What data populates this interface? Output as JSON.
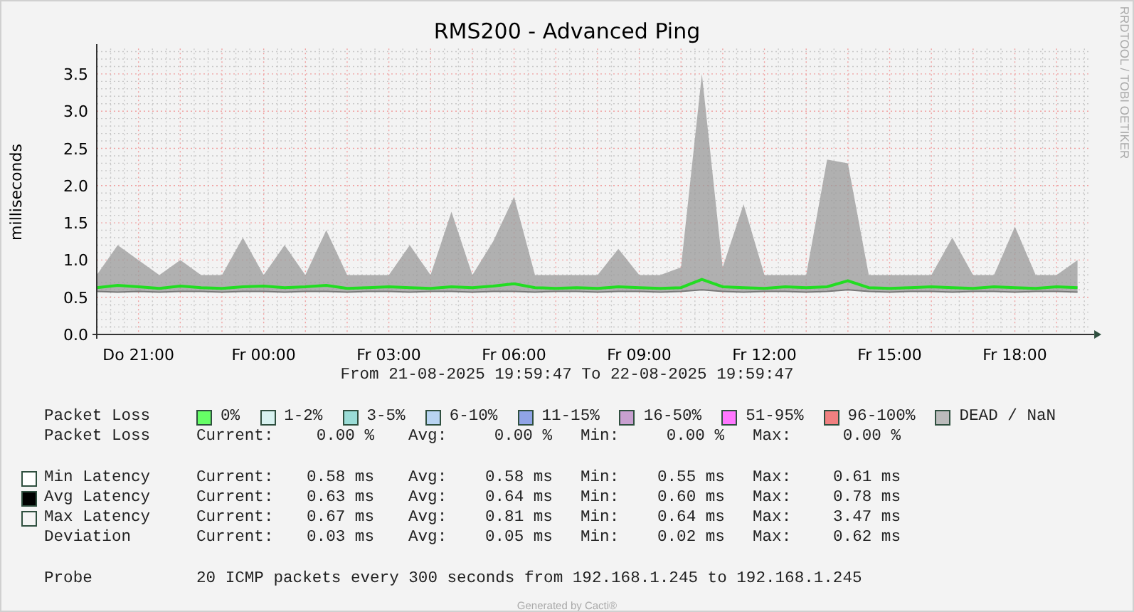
{
  "title": "RMS200 - Advanced Ping",
  "side_label": "RRDTOOL / TOBI OETIKER",
  "chart_data": {
    "type": "line",
    "grid": true,
    "ylabel": "milliseconds",
    "ylim": [
      0,
      3.84
    ],
    "categories": [
      null,
      null,
      "Do 21:00",
      null,
      null,
      null,
      null,
      null,
      "Fr 00:00",
      null,
      null,
      null,
      null,
      null,
      "Fr 03:00",
      null,
      null,
      null,
      null,
      null,
      "Fr 06:00",
      null,
      null,
      null,
      null,
      null,
      "Fr 09:00",
      null,
      null,
      null,
      null,
      null,
      "Fr 12:00",
      null,
      null,
      null,
      null,
      null,
      "Fr 15:00",
      null,
      null,
      null,
      null,
      null,
      "Fr 18:00",
      null,
      null,
      null
    ],
    "yticks": [
      {
        "value": 0,
        "label": "0.0"
      },
      {
        "value": 0.5,
        "label": "0.5"
      },
      {
        "value": 1,
        "label": "1.0"
      },
      {
        "value": 1.5,
        "label": "1.5"
      },
      {
        "value": 2,
        "label": "2.0"
      },
      {
        "value": 2.5,
        "label": "2.5"
      },
      {
        "value": 3,
        "label": "3.0"
      },
      {
        "value": 3.5,
        "label": "3.5"
      }
    ],
    "series": [
      {
        "color": "#777777",
        "values": [
          0.58,
          0.57,
          0.58,
          0.57,
          0.58,
          0.58,
          0.57,
          0.58,
          0.58,
          0.57,
          0.58,
          0.58,
          0.57,
          0.58,
          0.58,
          0.57,
          0.58,
          0.58,
          0.57,
          0.58,
          0.58,
          0.57,
          0.58,
          0.58,
          0.57,
          0.58,
          0.58,
          0.57,
          0.58,
          0.6,
          0.58,
          0.57,
          0.58,
          0.58,
          0.57,
          0.58,
          0.6,
          0.58,
          0.57,
          0.58,
          0.58,
          0.57,
          0.58,
          0.58,
          0.57,
          0.58,
          0.58,
          0.57
        ]
      },
      {
        "color": "#22dd22",
        "values": [
          0.63,
          0.66,
          0.64,
          0.62,
          0.65,
          0.63,
          0.62,
          0.64,
          0.65,
          0.63,
          0.64,
          0.66,
          0.62,
          0.63,
          0.64,
          0.63,
          0.62,
          0.64,
          0.63,
          0.65,
          0.68,
          0.63,
          0.62,
          0.63,
          0.62,
          0.64,
          0.63,
          0.62,
          0.63,
          0.74,
          0.64,
          0.63,
          0.62,
          0.64,
          0.63,
          0.64,
          0.72,
          0.63,
          0.62,
          0.63,
          0.64,
          0.63,
          0.62,
          0.64,
          0.63,
          0.62,
          0.64,
          0.63
        ]
      },
      {
        "type": "area",
        "color": "#999999",
        "values": [
          0.8,
          1.2,
          1.0,
          0.8,
          1.0,
          0.8,
          0.8,
          1.3,
          0.8,
          1.2,
          0.8,
          1.4,
          0.8,
          0.8,
          0.8,
          1.2,
          0.8,
          1.65,
          0.8,
          1.25,
          1.85,
          0.8,
          0.8,
          0.8,
          0.8,
          1.15,
          0.8,
          0.8,
          0.9,
          3.5,
          0.9,
          1.75,
          0.8,
          0.8,
          0.8,
          2.35,
          2.3,
          0.8,
          0.8,
          0.8,
          0.8,
          1.3,
          0.8,
          0.8,
          1.45,
          0.8,
          0.8,
          1.0
        ]
      }
    ]
  },
  "period": "From 21-08-2025 19:59:47 To 22-08-2025 19:59:47",
  "loss_legend": {
    "label": "Packet Loss",
    "items": [
      {
        "label": "0%",
        "color": "#66ff66"
      },
      {
        "label": "1-2%",
        "color": "#d8f2f0"
      },
      {
        "label": "3-5%",
        "color": "#9adcd6"
      },
      {
        "label": "6-10%",
        "color": "#b8d4f2"
      },
      {
        "label": "11-15%",
        "color": "#90a4e6"
      },
      {
        "label": "16-50%",
        "color": "#c8a0d0"
      },
      {
        "label": "51-95%",
        "color": "#ff77ff"
      },
      {
        "label": "96-100%",
        "color": "#f08080"
      },
      {
        "label": "DEAD / NaN",
        "color": "#bbbbbb"
      }
    ]
  },
  "stat_rows": [
    {
      "name": "Packet Loss",
      "stats": [
        {
          "label": "Current:",
          "value": "0.00 %"
        },
        {
          "label": "Avg:",
          "value": "0.00 %"
        },
        {
          "label": "Min:",
          "value": "0.00 %"
        },
        {
          "label": "Max:",
          "value": "0.00 %"
        }
      ]
    },
    {
      "kind": "gap"
    },
    {
      "name": "Min Latency",
      "color": "#ffffff",
      "stats": [
        {
          "label": "Current:",
          "value": "0.58 ms"
        },
        {
          "label": "Avg:",
          "value": "0.58 ms"
        },
        {
          "label": "Min:",
          "value": "0.55 ms"
        },
        {
          "label": "Max:",
          "value": "0.61 ms"
        }
      ]
    },
    {
      "name": "Avg Latency",
      "color": "#000000",
      "stats": [
        {
          "label": "Current:",
          "value": "0.63 ms"
        },
        {
          "label": "Avg:",
          "value": "0.64 ms"
        },
        {
          "label": "Min:",
          "value": "0.60 ms"
        },
        {
          "label": "Max:",
          "value": "0.78 ms"
        }
      ]
    },
    {
      "name": "Max Latency",
      "color": "#f4f4f4",
      "stats": [
        {
          "label": "Current:",
          "value": "0.67 ms"
        },
        {
          "label": "Avg:",
          "value": "0.81 ms"
        },
        {
          "label": "Min:",
          "value": "0.64 ms"
        },
        {
          "label": "Max:",
          "value": "3.47 ms"
        }
      ]
    },
    {
      "name": "Deviation",
      "stats": [
        {
          "label": "Current:",
          "value": "0.03 ms"
        },
        {
          "label": "Avg:",
          "value": "0.05 ms"
        },
        {
          "label": "Min:",
          "value": "0.02 ms"
        },
        {
          "label": "Max:",
          "value": "0.62 ms"
        }
      ]
    },
    {
      "kind": "gap"
    }
  ],
  "probe": {
    "label": "Probe",
    "text": "20 ICMP packets every 300 seconds from 192.168.1.245 to 192.168.1.245"
  },
  "footer": "Generated by Cacti®"
}
